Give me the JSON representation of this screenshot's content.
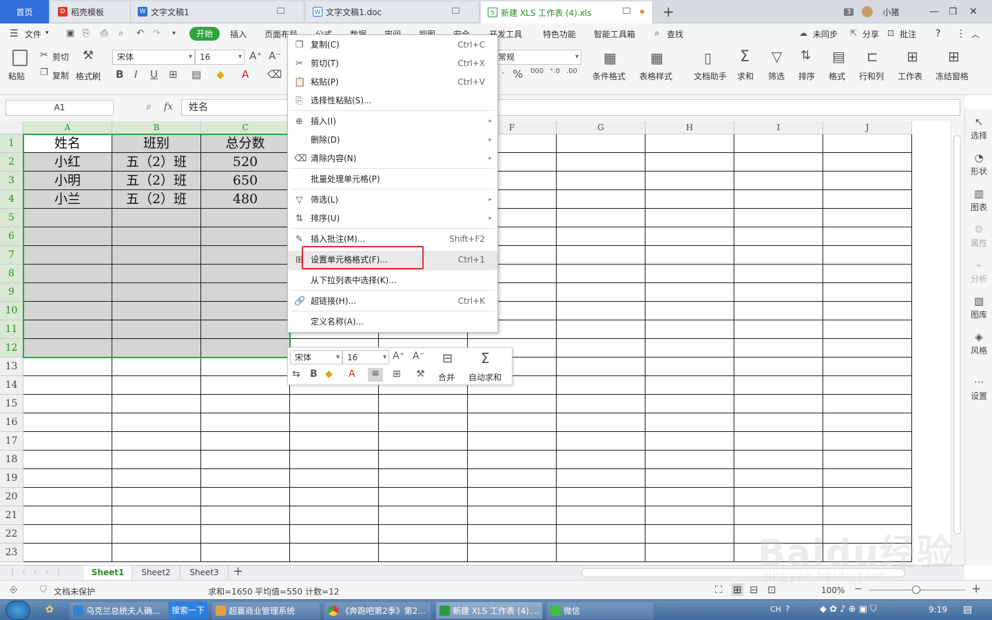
{
  "tabs": [
    {
      "label": "首页"
    },
    {
      "label": "稻壳模板"
    },
    {
      "label": "文字文稿1"
    },
    {
      "label": "文字文稿1.doc"
    },
    {
      "label": "新建 XLS 工作表 (4).xls"
    }
  ],
  "titlebar": {
    "window_count": "3",
    "user": "小猪"
  },
  "menu": {
    "file": "文件",
    "items": [
      "开始",
      "插入",
      "页面布局",
      "公式",
      "数据",
      "审阅",
      "视图",
      "安全",
      "开发工具",
      "特色功能",
      "智能工具箱"
    ],
    "search": "查找",
    "sync": "未同步",
    "share": "分享",
    "comment": "批注"
  },
  "ribbon": {
    "paste": "粘贴",
    "cut": "剪切",
    "copy": "复制",
    "format_painter": "格式刷",
    "font_name": "宋体",
    "font_size": "16",
    "number_format": "常规",
    "cond_format": "条件格式",
    "table_style": "表格样式",
    "doc_assistant": "文档助手",
    "sum": "求和",
    "filter": "筛选",
    "sort": "排序",
    "format": "格式",
    "rowcol": "行和列",
    "worksheet": "工作表",
    "freeze": "冻结窗格"
  },
  "formula": {
    "cell_ref": "A1",
    "fx": "fx",
    "value": "姓名"
  },
  "grid": {
    "columns": [
      "A",
      "B",
      "C",
      "D",
      "E",
      "F",
      "G",
      "H",
      "I",
      "J"
    ],
    "rows": [
      "1",
      "2",
      "3",
      "4",
      "5",
      "6",
      "7",
      "8",
      "9",
      "10",
      "11",
      "12",
      "13",
      "14",
      "15",
      "16",
      "17",
      "18",
      "19",
      "20",
      "21",
      "22",
      "23"
    ],
    "data": [
      [
        "姓名",
        "班别",
        "总分数"
      ],
      [
        "小红",
        "五（2）班",
        "520"
      ],
      [
        "小明",
        "五（2）班",
        "650"
      ],
      [
        "小兰",
        "五（2）班",
        "480"
      ]
    ]
  },
  "context_menu": [
    {
      "label": "复制(C)",
      "shortcut": "Ctrl+C",
      "icon": "copy-icon"
    },
    {
      "label": "剪切(T)",
      "shortcut": "Ctrl+X",
      "icon": "scissors-icon"
    },
    {
      "label": "粘贴(P)",
      "shortcut": "Ctrl+V",
      "icon": "paste-icon"
    },
    {
      "label": "选择性粘贴(S)...",
      "shortcut": "",
      "icon": "paste-special-icon"
    },
    {
      "label": "插入(I)",
      "shortcut": "",
      "icon": "insert-icon",
      "submenu": "▸"
    },
    {
      "label": "删除(D)",
      "shortcut": "",
      "icon": "",
      "submenu": "▸"
    },
    {
      "label": "清除内容(N)",
      "shortcut": "",
      "icon": "eraser-icon",
      "submenu": "▸"
    },
    {
      "label": "批量处理单元格(P)",
      "shortcut": "",
      "icon": ""
    },
    {
      "label": "筛选(L)",
      "shortcut": "",
      "icon": "filter-icon",
      "submenu": "▸"
    },
    {
      "label": "排序(U)",
      "shortcut": "",
      "icon": "sort-icon",
      "submenu": "▸"
    },
    {
      "label": "插入批注(M)...",
      "shortcut": "Shift+F2",
      "icon": "comment-icon"
    },
    {
      "label": "设置单元格格式(F)...",
      "shortcut": "Ctrl+1",
      "icon": "format-cells-icon"
    },
    {
      "label": "从下拉列表中选择(K)...",
      "shortcut": "",
      "icon": ""
    },
    {
      "label": "超链接(H)...",
      "shortcut": "Ctrl+K",
      "icon": "link-icon"
    },
    {
      "label": "定义名称(A)...",
      "shortcut": "",
      "icon": ""
    }
  ],
  "mini_toolbar": {
    "font": "宋体",
    "size": "16",
    "merge": "合并",
    "autosum": "自动求和"
  },
  "side_panel": [
    "选择",
    "形状",
    "图表",
    "属性",
    "分析",
    "图库",
    "风格",
    "设置"
  ],
  "sheets": [
    "Sheet1",
    "Sheet2",
    "Sheet3"
  ],
  "status": {
    "protect": "文档未保护",
    "sum": "求和=1650",
    "avg": "平均值=550",
    "count": "计数=12",
    "zoom": "100%"
  },
  "taskbar": {
    "items": [
      "乌克兰总统夫人确...",
      "搜索一下",
      "超赢商业管理系统",
      "《奔跑吧第2季》第2...",
      "新建 XLS 工作表 (4)....",
      "微信"
    ],
    "lang": "CH",
    "time": "9:19"
  },
  "watermark": "Baidu经验",
  "watermark_url": "jingyan.baidu.com"
}
